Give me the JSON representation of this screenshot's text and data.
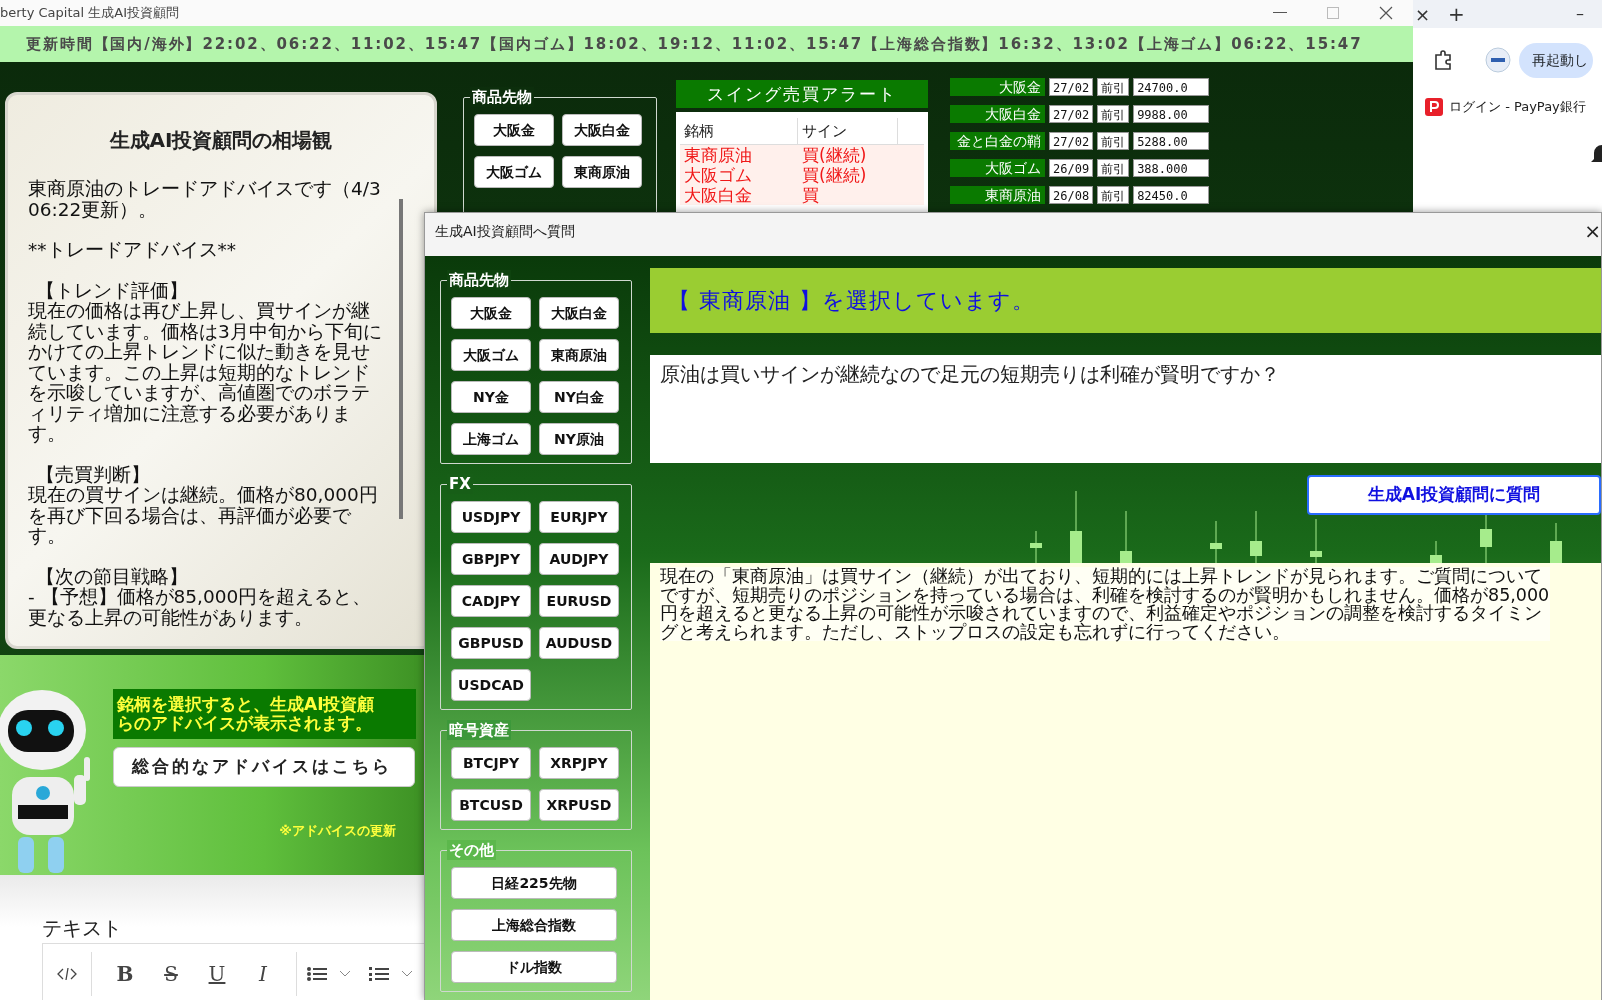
{
  "main_window": {
    "title": "berty Capital 生成AI投資顧問"
  },
  "update_bar": {
    "text": "更新時間【国内/海外】22:02、06:22、11:02、15:47【国内ゴム】18:02、19:12、11:02、15:47【上海総合指数】16:32、13:02【上海ゴム】06:22、15:47"
  },
  "advice_panel": {
    "title": "生成AI投資顧問の相場観",
    "body": [
      {
        "kind": "text",
        "text": "東商原油のトレードアドバイスです（4/3 06:22更新）。"
      },
      {
        "kind": "text",
        "text": "**トレードアドバイス**"
      },
      {
        "kind": "heading",
        "text": "【トレンド評価】"
      },
      {
        "kind": "text",
        "text": "現在の価格は再び上昇し、買サインが継続しています。価格は3月中旬から下旬にかけての上昇トレンドに似た動きを見せています。この上昇は短期的なトレンドを示唆していますが、高値圏でのボラティリティ増加に注意する必要があります。"
      },
      {
        "kind": "heading",
        "text": "【売買判断】"
      },
      {
        "kind": "text",
        "text": "現在の買サインは継続。価格が80,000円を再び下回る場合は、再評価が必要です。"
      },
      {
        "kind": "heading",
        "text": "【次の節目戦略】"
      },
      {
        "kind": "text",
        "text": "- 【予想】価格が85,000円を超えると、更なる上昇の可能性があります。"
      }
    ]
  },
  "futures_group": {
    "label": "商品先物",
    "buttons": [
      "大阪金",
      "大阪白金",
      "大阪ゴム",
      "東商原油"
    ]
  },
  "swing_alert": {
    "title": "スイング売買アラート",
    "columns": [
      "銘柄",
      "サイン"
    ],
    "rows": [
      {
        "name": "東商原油",
        "sign": "買(継続)"
      },
      {
        "name": "大阪ゴム",
        "sign": "買(継続)"
      },
      {
        "name": "大阪白金",
        "sign": "買"
      }
    ]
  },
  "prices": [
    {
      "name": "大阪金",
      "date": "27/02",
      "session": "前引",
      "value": "24700.0"
    },
    {
      "name": "大阪白金",
      "date": "27/02",
      "session": "前引",
      "value": "9988.00"
    },
    {
      "name": "金と白金の鞘",
      "date": "27/02",
      "session": "前引",
      "value": "5288.00"
    },
    {
      "name": "大阪ゴム",
      "date": "26/09",
      "session": "前引",
      "value": "388.000"
    },
    {
      "name": "東商原油",
      "date": "26/08",
      "session": "前引",
      "value": "82450.0"
    }
  ],
  "robot_section": {
    "message": [
      "銘柄を選択すると、生成AI投資顧",
      "らのアドバイスが表示されます。"
    ],
    "advice_button": "総合的なアドバイスはこちら",
    "note": "※アドバイスの更新"
  },
  "editor": {
    "label": "テキスト",
    "format_buttons": [
      {
        "kind": "bold",
        "glyph": "B"
      },
      {
        "kind": "strike",
        "glyph": "S"
      },
      {
        "kind": "underline",
        "glyph": "U"
      },
      {
        "kind": "italic",
        "glyph": "I"
      }
    ]
  },
  "browser": {
    "tab_close": "×",
    "new_tab": "+",
    "minimize": "–",
    "restart_button": "再起動し",
    "bookmark": "ログイン - PayPay銀行"
  },
  "dialog": {
    "title": "生成AI投資顧問へ質問",
    "close": "×",
    "groups": [
      {
        "kind": "grid",
        "label": "商品先物",
        "buttons": [
          "大阪金",
          "大阪白金",
          "大阪ゴム",
          "東商原油",
          "NY金",
          "NY白金",
          "上海ゴム",
          "NY原油"
        ]
      },
      {
        "kind": "grid",
        "label": "FX",
        "buttons": [
          "USDJPY",
          "EURJPY",
          "GBPJPY",
          "AUDJPY",
          "CADJPY",
          "EURUSD",
          "GBPUSD",
          "AUDUSD",
          "USDCAD"
        ]
      },
      {
        "kind": "grid",
        "label": "暗号資産",
        "buttons": [
          "BTCJPY",
          "XRPJPY",
          "BTCUSD",
          "XRPUSD"
        ]
      },
      {
        "kind": "wide",
        "label": "その他",
        "buttons": [
          "日経225先物",
          "上海総合指数",
          "ドル指数"
        ]
      }
    ],
    "selection_banner": "【 東商原油 】を選択しています。",
    "question": "原油は買いサインが継続なので足元の短期売りは利確が賢明ですか？",
    "ask_button": "生成AI投資顧問に質問",
    "answer": "現在の「東商原油」は買サイン（継続）が出ており、短期的には上昇トレンドが見られます。ご質問についてですが、短期売りのポジションを持っている場合は、利確を検討するのが賢明かもしれません。価格が85,000円を超えると更なる上昇の可能性が示唆されていますので、利益確定やポジションの調整を検討するタイミングと考えられます。ただし、ストップロスの設定も忘れずに行ってください。"
  }
}
